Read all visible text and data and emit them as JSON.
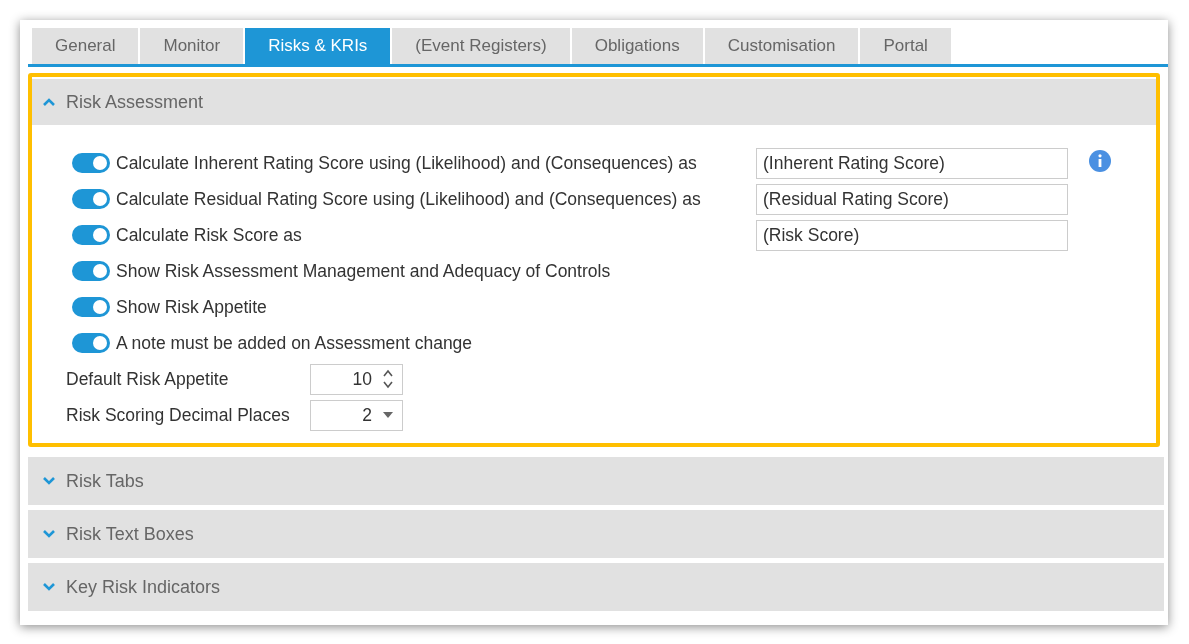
{
  "tabs": [
    {
      "label": "General",
      "selected": false
    },
    {
      "label": "Monitor",
      "selected": false
    },
    {
      "label": "Risks & KRIs",
      "selected": true
    },
    {
      "label": "(Event Registers)",
      "selected": false
    },
    {
      "label": "Obligations",
      "selected": false
    },
    {
      "label": "Customisation",
      "selected": false
    },
    {
      "label": "Portal",
      "selected": false
    }
  ],
  "sections": [
    {
      "title": "Risk Assessment",
      "expanded": true,
      "highlighted": true,
      "toggles": [
        {
          "label": "Calculate Inherent Rating Score using (Likelihood) and (Consequences) as",
          "on": true,
          "field": {
            "value": "(Inherent Rating Score)"
          }
        },
        {
          "label": "Calculate Residual Rating Score using (Likelihood) and (Consequences) as",
          "on": true,
          "field": {
            "value": "(Residual Rating Score)"
          }
        },
        {
          "label": "Calculate Risk Score as",
          "on": true,
          "field": {
            "value": "(Risk Score)"
          }
        },
        {
          "label": "Show Risk Assessment Management and Adequacy of Controls",
          "on": true
        },
        {
          "label": "Show Risk Appetite",
          "on": true
        },
        {
          "label": "A note must be added on Assessment change",
          "on": true
        }
      ],
      "inputs": [
        {
          "label": "Default Risk Appetite",
          "value": "10",
          "kind": "spinner"
        },
        {
          "label": "Risk Scoring Decimal Places",
          "value": "2",
          "kind": "dropdown"
        }
      ]
    },
    {
      "title": "Risk Tabs",
      "expanded": false,
      "highlighted": false
    },
    {
      "title": "Risk Text Boxes",
      "expanded": false,
      "highlighted": false
    },
    {
      "title": "Key Risk Indicators",
      "expanded": false,
      "highlighted": false
    }
  ]
}
